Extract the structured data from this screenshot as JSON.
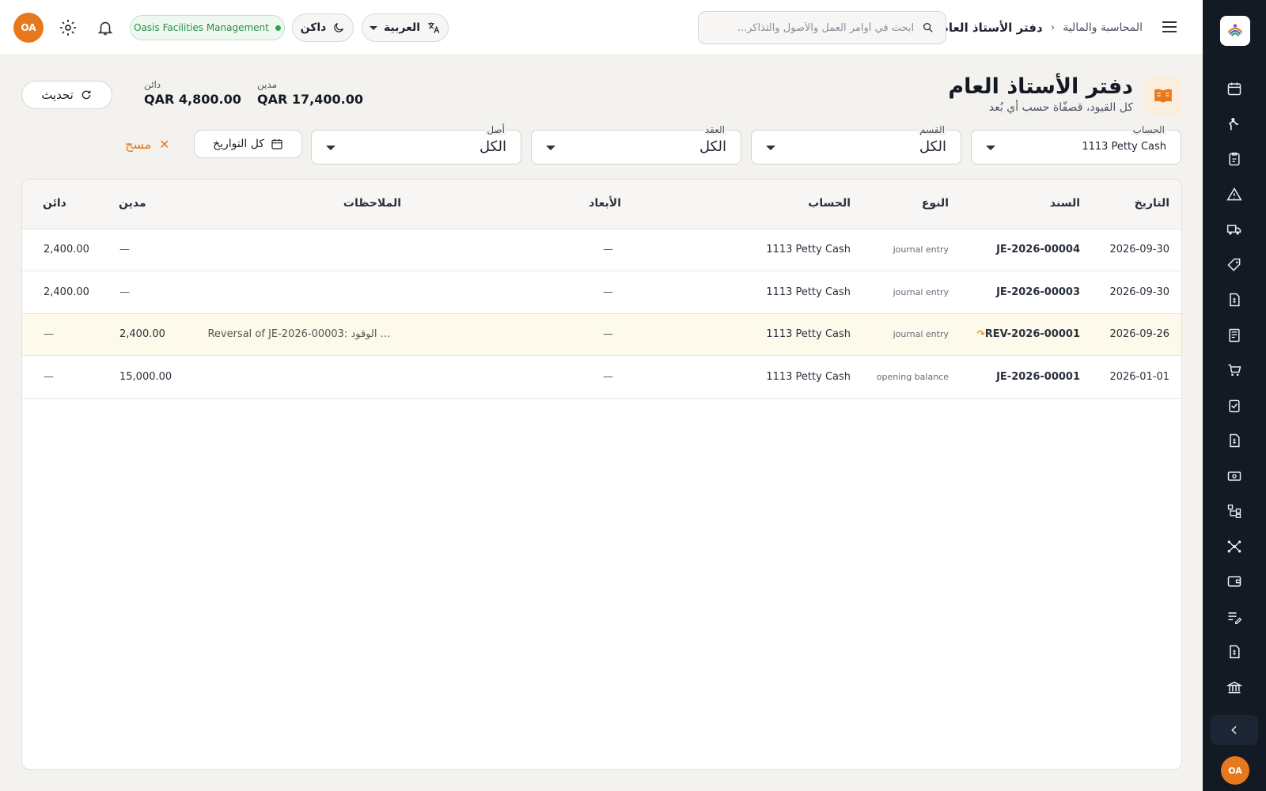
{
  "rail": {
    "icons": [
      "calendar-icon",
      "person-icon",
      "clipboard-icon",
      "warning-icon",
      "truck-icon",
      "tag-icon",
      "invoice-icon",
      "book-icon",
      "cart-icon",
      "checklist-icon",
      "bill-icon",
      "cash-icon",
      "hierarchy-icon",
      "network-icon",
      "wallet-icon",
      "list-edit-icon",
      "receipt-icon",
      "bank-icon"
    ],
    "avatar_initials": "OA"
  },
  "topbar": {
    "breadcrumb_parent": "المحاسبة والمالية",
    "breadcrumb_current": "دفتر الأستاذ العام",
    "search_placeholder": "ابحث في أوامر العمل والأصول والتذاكر...",
    "language_label": "العربية",
    "theme_label": "داكن",
    "organization": "Oasis Facilities Management",
    "avatar_initials": "OA"
  },
  "header": {
    "title": "دفتر الأستاذ العام",
    "subtitle": "كل القيود، قصفّاة حسب أي بُعد",
    "debit_label": "مدين",
    "debit_value": "QAR 17,400.00",
    "credit_label": "دائن",
    "credit_value": "QAR 4,800.00",
    "refresh_label": "تحديث"
  },
  "filters": {
    "account": {
      "label": "الحساب",
      "value": "1113  Petty Cash"
    },
    "department": {
      "label": "القسم",
      "value": "الكل"
    },
    "contract": {
      "label": "العقد",
      "value": "الكل"
    },
    "asset": {
      "label": "أصل",
      "value": "الكل"
    },
    "date_range": "كل التواريخ",
    "clear_label": "مسح"
  },
  "table": {
    "columns": {
      "date": "التاريخ",
      "voucher": "السند",
      "type": "النوع",
      "account": "الحساب",
      "dimensions": "الأبعاد",
      "notes": "الملاحظات",
      "debit": "مدين",
      "credit": "دائن"
    },
    "rows": [
      {
        "date": "2026-09-30",
        "voucher": "JE-2026-00004",
        "type": "journal entry",
        "account": "1113  Petty Cash",
        "dimensions": "—",
        "notes": "",
        "debit": "—",
        "credit": "2,400.00",
        "reversal": false
      },
      {
        "date": "2026-09-30",
        "voucher": "JE-2026-00003",
        "type": "journal entry",
        "account": "1113  Petty Cash",
        "dimensions": "—",
        "notes": "",
        "debit": "—",
        "credit": "2,400.00",
        "reversal": false
      },
      {
        "date": "2026-09-26",
        "voucher": "REV-2026-00001",
        "type": "journal entry",
        "account": "1113  Petty Cash",
        "dimensions": "—",
        "notes": "Reversal of JE-2026-00003: الوقود ...",
        "debit": "2,400.00",
        "credit": "—",
        "reversal": true
      },
      {
        "date": "2026-01-01",
        "voucher": "JE-2026-00001",
        "type": "opening balance",
        "account": "1113  Petty Cash",
        "dimensions": "—",
        "notes": "",
        "debit": "15,000.00",
        "credit": "—",
        "reversal": false
      }
    ]
  },
  "colors": {
    "accent": "#e8781e",
    "rail_bg": "#131a24",
    "status_green": "#2fa552",
    "highlight_row": "#fdfaeb"
  }
}
